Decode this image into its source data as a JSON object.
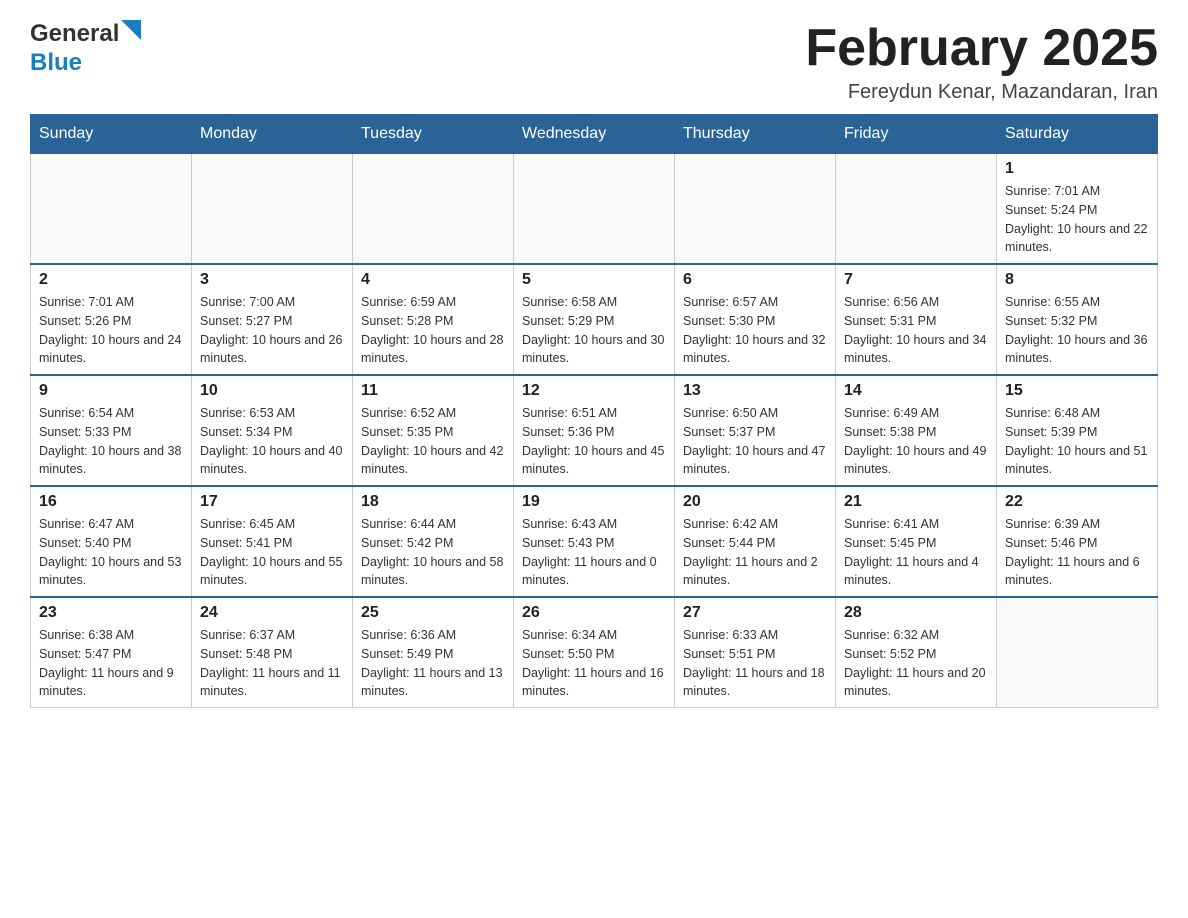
{
  "logo": {
    "text_general": "General",
    "text_blue": "Blue"
  },
  "header": {
    "month_title": "February 2025",
    "location": "Fereydun Kenar, Mazandaran, Iran"
  },
  "weekdays": [
    "Sunday",
    "Monday",
    "Tuesday",
    "Wednesday",
    "Thursday",
    "Friday",
    "Saturday"
  ],
  "weeks": [
    [
      {
        "day": "",
        "sunrise": "",
        "sunset": "",
        "daylight": ""
      },
      {
        "day": "",
        "sunrise": "",
        "sunset": "",
        "daylight": ""
      },
      {
        "day": "",
        "sunrise": "",
        "sunset": "",
        "daylight": ""
      },
      {
        "day": "",
        "sunrise": "",
        "sunset": "",
        "daylight": ""
      },
      {
        "day": "",
        "sunrise": "",
        "sunset": "",
        "daylight": ""
      },
      {
        "day": "",
        "sunrise": "",
        "sunset": "",
        "daylight": ""
      },
      {
        "day": "1",
        "sunrise": "Sunrise: 7:01 AM",
        "sunset": "Sunset: 5:24 PM",
        "daylight": "Daylight: 10 hours and 22 minutes."
      }
    ],
    [
      {
        "day": "2",
        "sunrise": "Sunrise: 7:01 AM",
        "sunset": "Sunset: 5:26 PM",
        "daylight": "Daylight: 10 hours and 24 minutes."
      },
      {
        "day": "3",
        "sunrise": "Sunrise: 7:00 AM",
        "sunset": "Sunset: 5:27 PM",
        "daylight": "Daylight: 10 hours and 26 minutes."
      },
      {
        "day": "4",
        "sunrise": "Sunrise: 6:59 AM",
        "sunset": "Sunset: 5:28 PM",
        "daylight": "Daylight: 10 hours and 28 minutes."
      },
      {
        "day": "5",
        "sunrise": "Sunrise: 6:58 AM",
        "sunset": "Sunset: 5:29 PM",
        "daylight": "Daylight: 10 hours and 30 minutes."
      },
      {
        "day": "6",
        "sunrise": "Sunrise: 6:57 AM",
        "sunset": "Sunset: 5:30 PM",
        "daylight": "Daylight: 10 hours and 32 minutes."
      },
      {
        "day": "7",
        "sunrise": "Sunrise: 6:56 AM",
        "sunset": "Sunset: 5:31 PM",
        "daylight": "Daylight: 10 hours and 34 minutes."
      },
      {
        "day": "8",
        "sunrise": "Sunrise: 6:55 AM",
        "sunset": "Sunset: 5:32 PM",
        "daylight": "Daylight: 10 hours and 36 minutes."
      }
    ],
    [
      {
        "day": "9",
        "sunrise": "Sunrise: 6:54 AM",
        "sunset": "Sunset: 5:33 PM",
        "daylight": "Daylight: 10 hours and 38 minutes."
      },
      {
        "day": "10",
        "sunrise": "Sunrise: 6:53 AM",
        "sunset": "Sunset: 5:34 PM",
        "daylight": "Daylight: 10 hours and 40 minutes."
      },
      {
        "day": "11",
        "sunrise": "Sunrise: 6:52 AM",
        "sunset": "Sunset: 5:35 PM",
        "daylight": "Daylight: 10 hours and 42 minutes."
      },
      {
        "day": "12",
        "sunrise": "Sunrise: 6:51 AM",
        "sunset": "Sunset: 5:36 PM",
        "daylight": "Daylight: 10 hours and 45 minutes."
      },
      {
        "day": "13",
        "sunrise": "Sunrise: 6:50 AM",
        "sunset": "Sunset: 5:37 PM",
        "daylight": "Daylight: 10 hours and 47 minutes."
      },
      {
        "day": "14",
        "sunrise": "Sunrise: 6:49 AM",
        "sunset": "Sunset: 5:38 PM",
        "daylight": "Daylight: 10 hours and 49 minutes."
      },
      {
        "day": "15",
        "sunrise": "Sunrise: 6:48 AM",
        "sunset": "Sunset: 5:39 PM",
        "daylight": "Daylight: 10 hours and 51 minutes."
      }
    ],
    [
      {
        "day": "16",
        "sunrise": "Sunrise: 6:47 AM",
        "sunset": "Sunset: 5:40 PM",
        "daylight": "Daylight: 10 hours and 53 minutes."
      },
      {
        "day": "17",
        "sunrise": "Sunrise: 6:45 AM",
        "sunset": "Sunset: 5:41 PM",
        "daylight": "Daylight: 10 hours and 55 minutes."
      },
      {
        "day": "18",
        "sunrise": "Sunrise: 6:44 AM",
        "sunset": "Sunset: 5:42 PM",
        "daylight": "Daylight: 10 hours and 58 minutes."
      },
      {
        "day": "19",
        "sunrise": "Sunrise: 6:43 AM",
        "sunset": "Sunset: 5:43 PM",
        "daylight": "Daylight: 11 hours and 0 minutes."
      },
      {
        "day": "20",
        "sunrise": "Sunrise: 6:42 AM",
        "sunset": "Sunset: 5:44 PM",
        "daylight": "Daylight: 11 hours and 2 minutes."
      },
      {
        "day": "21",
        "sunrise": "Sunrise: 6:41 AM",
        "sunset": "Sunset: 5:45 PM",
        "daylight": "Daylight: 11 hours and 4 minutes."
      },
      {
        "day": "22",
        "sunrise": "Sunrise: 6:39 AM",
        "sunset": "Sunset: 5:46 PM",
        "daylight": "Daylight: 11 hours and 6 minutes."
      }
    ],
    [
      {
        "day": "23",
        "sunrise": "Sunrise: 6:38 AM",
        "sunset": "Sunset: 5:47 PM",
        "daylight": "Daylight: 11 hours and 9 minutes."
      },
      {
        "day": "24",
        "sunrise": "Sunrise: 6:37 AM",
        "sunset": "Sunset: 5:48 PM",
        "daylight": "Daylight: 11 hours and 11 minutes."
      },
      {
        "day": "25",
        "sunrise": "Sunrise: 6:36 AM",
        "sunset": "Sunset: 5:49 PM",
        "daylight": "Daylight: 11 hours and 13 minutes."
      },
      {
        "day": "26",
        "sunrise": "Sunrise: 6:34 AM",
        "sunset": "Sunset: 5:50 PM",
        "daylight": "Daylight: 11 hours and 16 minutes."
      },
      {
        "day": "27",
        "sunrise": "Sunrise: 6:33 AM",
        "sunset": "Sunset: 5:51 PM",
        "daylight": "Daylight: 11 hours and 18 minutes."
      },
      {
        "day": "28",
        "sunrise": "Sunrise: 6:32 AM",
        "sunset": "Sunset: 5:52 PM",
        "daylight": "Daylight: 11 hours and 20 minutes."
      },
      {
        "day": "",
        "sunrise": "",
        "sunset": "",
        "daylight": ""
      }
    ]
  ]
}
